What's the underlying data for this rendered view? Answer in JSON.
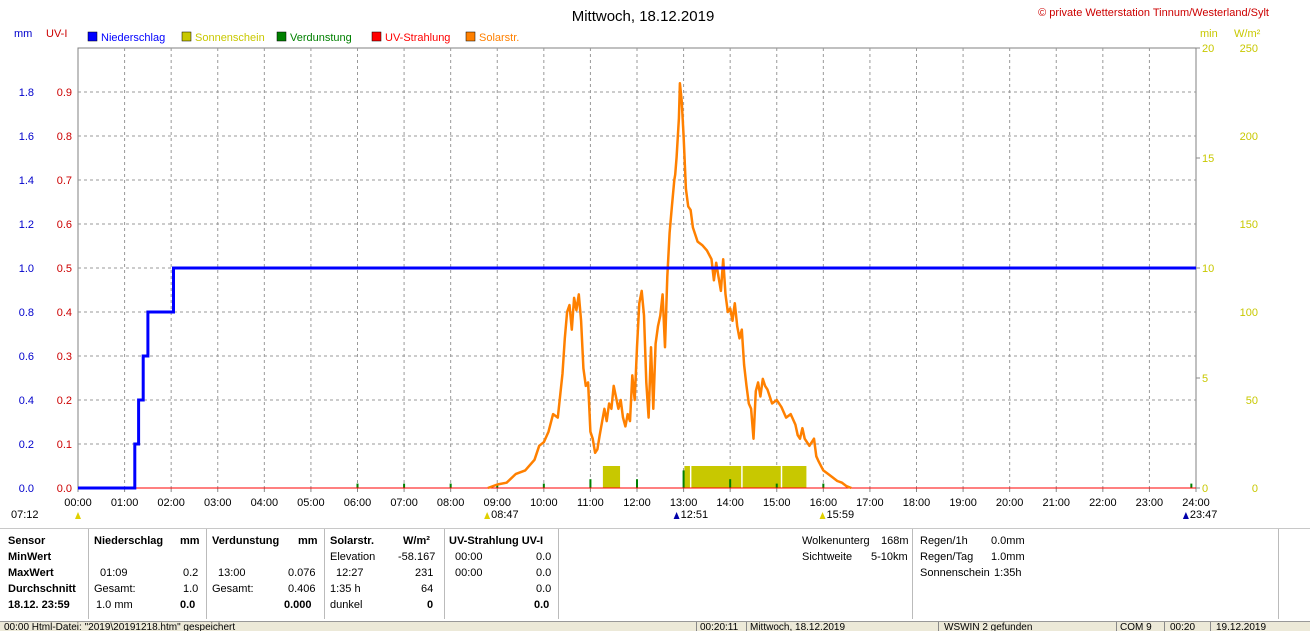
{
  "chart_data": {
    "type": "line",
    "title": "Mittwoch, 18.12.2019",
    "copyright": "© private Wetterstation Tinnum/Westerland/Sylt",
    "unit_labels": {
      "mm": "mm",
      "uvi": "UV-I",
      "min": "min",
      "wm2": "W/m²"
    },
    "legend": [
      {
        "name": "Niederschlag",
        "color": "#0000ff"
      },
      {
        "name": "Sonnenschein",
        "color": "#c8c800"
      },
      {
        "name": "Verdunstung",
        "color": "#008000"
      },
      {
        "name": "UV-Strahlung",
        "color": "#ff0000"
      },
      {
        "name": "Solarstr.",
        "color": "#ff8000"
      }
    ],
    "x_ticks": [
      "00:00",
      "01:00",
      "02:00",
      "03:00",
      "04:00",
      "05:00",
      "06:00",
      "07:00",
      "08:00",
      "09:00",
      "10:00",
      "11:00",
      "12:00",
      "13:00",
      "14:00",
      "15:00",
      "16:00",
      "17:00",
      "18:00",
      "19:00",
      "20:00",
      "21:00",
      "22:00",
      "23:00",
      "24:00"
    ],
    "xlim": [
      0,
      24
    ],
    "axes": {
      "mm": {
        "ticks": [
          "0.0",
          "0.2",
          "0.4",
          "0.6",
          "0.8",
          "1.0",
          "1.2",
          "1.4",
          "1.6",
          "1.8"
        ],
        "range": [
          0,
          2.0
        ],
        "color": "#0000cc"
      },
      "uvi": {
        "ticks": [
          "0.0",
          "0.1",
          "0.2",
          "0.3",
          "0.4",
          "0.5",
          "0.6",
          "0.7",
          "0.8",
          "0.9"
        ],
        "range": [
          0,
          1.0
        ],
        "color": "#cc0000"
      },
      "min": {
        "ticks": [
          "0",
          "5",
          "10",
          "15",
          "20"
        ],
        "range": [
          0,
          20
        ],
        "color": "#c8c800"
      },
      "wm2": {
        "ticks": [
          "0",
          "50",
          "100",
          "150",
          "200",
          "250"
        ],
        "range": [
          0,
          250
        ],
        "color": "#c8c800"
      }
    },
    "markers": [
      {
        "label": "07:12",
        "x": 0.0,
        "color": "#e0d000"
      },
      {
        "label": "08:47",
        "x": 8.783,
        "color": "#e0d000"
      },
      {
        "label": "12:51",
        "x": 12.85,
        "color": "#0000aa"
      },
      {
        "label": "15:59",
        "x": 15.983,
        "color": "#e0d000"
      },
      {
        "label": "23:47",
        "x": 23.783,
        "color": "#0000aa"
      }
    ],
    "series": [
      {
        "name": "Niederschlag",
        "color": "#0000ff",
        "axis": "mm",
        "step": true,
        "points": [
          [
            0,
            0
          ],
          [
            1.15,
            0
          ],
          [
            1.22,
            0.2
          ],
          [
            1.3,
            0.4
          ],
          [
            1.4,
            0.6
          ],
          [
            1.5,
            0.8
          ],
          [
            2.05,
            1.0
          ],
          [
            24,
            1.0
          ]
        ]
      },
      {
        "name": "Solarstr.",
        "color": "#ff8000",
        "axis": "wm2",
        "points": [
          [
            8.8,
            0
          ],
          [
            9.0,
            2
          ],
          [
            9.2,
            3
          ],
          [
            9.4,
            8
          ],
          [
            9.6,
            10
          ],
          [
            9.8,
            16
          ],
          [
            9.9,
            24
          ],
          [
            10.0,
            26
          ],
          [
            10.1,
            32
          ],
          [
            10.2,
            42
          ],
          [
            10.3,
            40
          ],
          [
            10.4,
            65
          ],
          [
            10.45,
            85
          ],
          [
            10.5,
            100
          ],
          [
            10.55,
            104
          ],
          [
            10.6,
            90
          ],
          [
            10.65,
            108
          ],
          [
            10.7,
            101
          ],
          [
            10.75,
            110
          ],
          [
            10.8,
            95
          ],
          [
            10.85,
            68
          ],
          [
            10.9,
            58
          ],
          [
            10.95,
            60
          ],
          [
            11.0,
            32
          ],
          [
            11.05,
            28
          ],
          [
            11.1,
            20
          ],
          [
            11.15,
            22
          ],
          [
            11.2,
            30
          ],
          [
            11.3,
            45
          ],
          [
            11.35,
            38
          ],
          [
            11.4,
            48
          ],
          [
            11.45,
            45
          ],
          [
            11.5,
            58
          ],
          [
            11.6,
            45
          ],
          [
            11.65,
            50
          ],
          [
            11.7,
            40
          ],
          [
            11.75,
            35
          ],
          [
            11.8,
            42
          ],
          [
            11.85,
            38
          ],
          [
            11.9,
            64
          ],
          [
            11.95,
            50
          ],
          [
            12.0,
            80
          ],
          [
            12.05,
            105
          ],
          [
            12.1,
            112
          ],
          [
            12.15,
            98
          ],
          [
            12.2,
            60
          ],
          [
            12.25,
            40
          ],
          [
            12.3,
            80
          ],
          [
            12.35,
            45
          ],
          [
            12.4,
            82
          ],
          [
            12.45,
            92
          ],
          [
            12.5,
            98
          ],
          [
            12.55,
            110
          ],
          [
            12.6,
            80
          ],
          [
            12.65,
            120
          ],
          [
            12.7,
            145
          ],
          [
            12.75,
            160
          ],
          [
            12.8,
            175
          ],
          [
            12.82,
            178
          ],
          [
            12.85,
            188
          ],
          [
            12.9,
            210
          ],
          [
            12.92,
            230
          ],
          [
            12.96,
            220
          ],
          [
            13.0,
            200
          ],
          [
            13.05,
            170
          ],
          [
            13.1,
            160
          ],
          [
            13.15,
            158
          ],
          [
            13.2,
            148
          ],
          [
            13.3,
            140
          ],
          [
            13.4,
            138
          ],
          [
            13.5,
            135
          ],
          [
            13.6,
            130
          ],
          [
            13.65,
            118
          ],
          [
            13.7,
            128
          ],
          [
            13.75,
            120
          ],
          [
            13.8,
            112
          ],
          [
            13.85,
            130
          ],
          [
            13.9,
            110
          ],
          [
            13.95,
            100
          ],
          [
            14.0,
            102
          ],
          [
            14.05,
            95
          ],
          [
            14.1,
            105
          ],
          [
            14.15,
            92
          ],
          [
            14.2,
            85
          ],
          [
            14.25,
            90
          ],
          [
            14.3,
            70
          ],
          [
            14.35,
            58
          ],
          [
            14.4,
            48
          ],
          [
            14.45,
            45
          ],
          [
            14.5,
            28
          ],
          [
            14.55,
            55
          ],
          [
            14.6,
            60
          ],
          [
            14.65,
            52
          ],
          [
            14.7,
            62
          ],
          [
            14.75,
            58
          ],
          [
            14.8,
            56
          ],
          [
            14.9,
            48
          ],
          [
            15.0,
            50
          ],
          [
            15.1,
            46
          ],
          [
            15.2,
            40
          ],
          [
            15.3,
            42
          ],
          [
            15.4,
            36
          ],
          [
            15.45,
            30
          ],
          [
            15.5,
            28
          ],
          [
            15.55,
            34
          ],
          [
            15.6,
            28
          ],
          [
            15.7,
            24
          ],
          [
            15.8,
            28
          ],
          [
            15.85,
            18
          ],
          [
            15.9,
            15
          ],
          [
            16.0,
            10
          ],
          [
            16.1,
            8
          ],
          [
            16.2,
            6
          ],
          [
            16.3,
            4
          ],
          [
            16.4,
            3
          ],
          [
            16.5,
            1
          ],
          [
            16.6,
            0
          ]
        ]
      },
      {
        "name": "Sonnenschein",
        "color": "#c8c800",
        "axis": "min",
        "type": "bars",
        "points": [
          [
            11.3,
            1
          ],
          [
            11.35,
            1
          ],
          [
            11.4,
            1
          ],
          [
            11.45,
            1
          ],
          [
            11.5,
            1
          ],
          [
            11.55,
            1
          ],
          [
            11.6,
            1
          ],
          [
            13.05,
            1
          ],
          [
            13.1,
            1
          ],
          [
            13.2,
            1
          ],
          [
            13.25,
            1
          ],
          [
            13.3,
            1
          ],
          [
            13.35,
            1
          ],
          [
            13.4,
            1
          ],
          [
            13.45,
            1
          ],
          [
            13.5,
            1
          ],
          [
            13.55,
            1
          ],
          [
            13.6,
            1
          ],
          [
            13.65,
            1
          ],
          [
            13.7,
            1
          ],
          [
            13.75,
            1
          ],
          [
            13.8,
            1
          ],
          [
            13.85,
            1
          ],
          [
            13.9,
            1
          ],
          [
            13.95,
            1
          ],
          [
            14.0,
            1
          ],
          [
            14.05,
            1
          ],
          [
            14.1,
            1
          ],
          [
            14.15,
            1
          ],
          [
            14.2,
            1
          ],
          [
            14.3,
            1
          ],
          [
            14.35,
            1
          ],
          [
            14.4,
            1
          ],
          [
            14.45,
            1
          ],
          [
            14.5,
            1
          ],
          [
            14.55,
            1
          ],
          [
            14.6,
            1
          ],
          [
            14.65,
            1
          ],
          [
            14.7,
            1
          ],
          [
            14.75,
            1
          ],
          [
            14.8,
            1
          ],
          [
            14.85,
            1
          ],
          [
            14.9,
            1
          ],
          [
            14.95,
            1
          ],
          [
            15.0,
            1
          ],
          [
            15.05,
            1
          ],
          [
            15.15,
            1
          ],
          [
            15.2,
            1
          ],
          [
            15.25,
            1
          ],
          [
            15.3,
            1
          ],
          [
            15.35,
            1
          ],
          [
            15.4,
            1
          ],
          [
            15.45,
            1
          ],
          [
            15.5,
            1
          ],
          [
            15.55,
            1
          ],
          [
            15.6,
            1
          ]
        ]
      },
      {
        "name": "Verdunstung",
        "color": "#008000",
        "axis": "mm",
        "type": "spikes",
        "points": [
          [
            6.0,
            0.02
          ],
          [
            7.0,
            0.02
          ],
          [
            8.0,
            0.02
          ],
          [
            9.0,
            0.02
          ],
          [
            10.0,
            0.02
          ],
          [
            11.0,
            0.04
          ],
          [
            12.0,
            0.04
          ],
          [
            13.0,
            0.08
          ],
          [
            14.0,
            0.04
          ],
          [
            15.0,
            0.02
          ],
          [
            16.0,
            0.02
          ],
          [
            23.9,
            0.02
          ]
        ]
      },
      {
        "name": "UV-Strahlung",
        "color": "#ff0000",
        "axis": "uvi",
        "points": [
          [
            0,
            0
          ],
          [
            24,
            0
          ]
        ]
      }
    ]
  },
  "panel": {
    "row_labels": [
      "Sensor",
      "MinWert",
      "MaxWert",
      "Durchschnitt",
      "18.12. 23:59"
    ],
    "niederschlag": {
      "header": "Niederschlag",
      "unit": "mm",
      "max_time": "01:09",
      "max_val": "0.2",
      "gesamt_label": "Gesamt:",
      "gesamt_val": "1.0",
      "avg_val": "1.0 mm",
      "sum_val": "0.0"
    },
    "verdunstung": {
      "header": "Verdunstung",
      "unit": "mm",
      "max_time": "13:00",
      "max_val": "0.076",
      "gesamt_label": "Gesamt:",
      "gesamt_val": "0.406",
      "sum_val": "0.000"
    },
    "solar": {
      "header": "Solarstr.",
      "unit": "W/m²",
      "elev_label": "Elevation",
      "elev_val": "-58.167",
      "max_time": "12:27",
      "max_val": "231",
      "dur_label": "1:35 h",
      "dur_val": "64",
      "dark_label": "dunkel",
      "dark_val": "0"
    },
    "uv": {
      "header": "UV-Strahlung UV-I",
      "min_time": "00:00",
      "min_val": "0.0",
      "max_time": "00:00",
      "max_val": "0.0",
      "avg_val": "0.0",
      "sum_val": "0.0"
    },
    "cloud": {
      "label1": "Wolkenunterg",
      "val1": "168m",
      "label2": "Sichtweite",
      "val2": "5-10km"
    },
    "rain": {
      "label1": "Regen/1h",
      "val1": "0.0mm",
      "label2": "Regen/Tag",
      "val2": "1.0mm",
      "label3": "Sonnenschein",
      "val3": "1:35h"
    }
  },
  "status": {
    "s1": "00:00  Html-Datei: \"2019\\20191218.htm\" gespeichert",
    "s2": "00:20:11",
    "s3": "Mittwoch, 18.12.2019",
    "s4": "WSWIN 2 gefunden",
    "s5": "COM 9",
    "s6": "00:20",
    "s7": "19.12.2019"
  }
}
